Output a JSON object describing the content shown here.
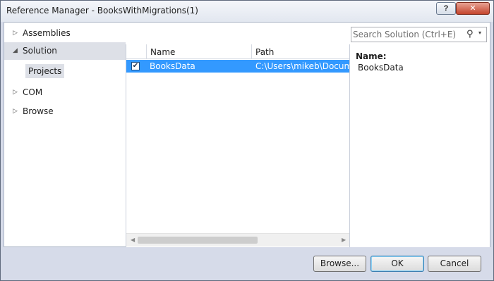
{
  "window": {
    "title": "Reference Manager - BooksWithMigrations(1)",
    "help_label": "?",
    "close_label": "✕"
  },
  "nav": {
    "items": [
      {
        "label": "Assemblies",
        "arrow": "▷"
      },
      {
        "label": "Solution",
        "arrow": "◢"
      },
      {
        "label": "COM",
        "arrow": "▷"
      },
      {
        "label": "Browse",
        "arrow": "▷"
      }
    ],
    "sub_item": "Projects"
  },
  "search": {
    "placeholder": "Search Solution (Ctrl+E)",
    "icon": "search-icon",
    "dropdown_glyph": "▾"
  },
  "grid": {
    "columns": [
      "Name",
      "Path"
    ],
    "rows": [
      {
        "checked": true,
        "check_glyph": "✔",
        "name": "BooksData",
        "path": "C:\\Users\\mikeb\\Documents"
      }
    ],
    "scroll": {
      "left": "◀",
      "right": "▶"
    }
  },
  "details": {
    "name_label": "Name:",
    "name_value": "BooksData"
  },
  "buttons": {
    "browse": "Browse...",
    "ok": "OK",
    "cancel": "Cancel"
  }
}
